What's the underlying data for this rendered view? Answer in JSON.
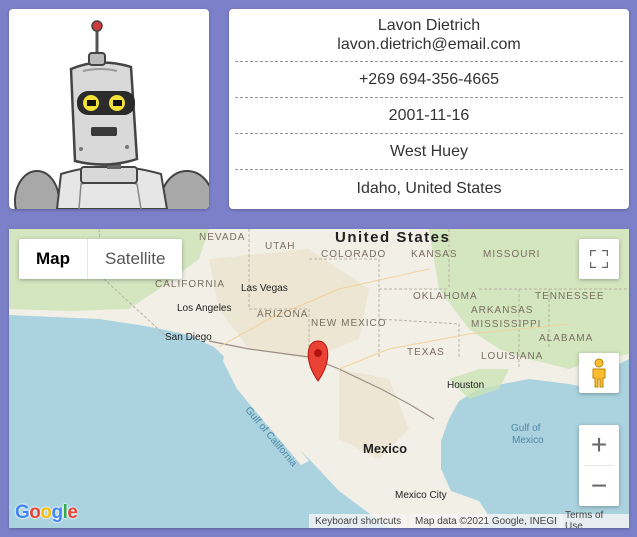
{
  "profile": {
    "name": "Lavon Dietrich",
    "email": "lavon.dietrich@email.com",
    "phone": "+269 694-356-4665",
    "birthdate": "2001-11-16",
    "city": "West Huey",
    "location": "Idaho, United States"
  },
  "map": {
    "type_control": {
      "map": "Map",
      "satellite": "Satellite",
      "selected": "Map"
    },
    "zoom_in": "+",
    "zoom_out": "−",
    "labels": {
      "united_states": "United States",
      "mexico": "Mexico",
      "nevada": "NEVADA",
      "utah": "UTAH",
      "colorado": "COLORADO",
      "kansas": "KANSAS",
      "missouri": "MISSOURI",
      "california": "CALIFORNIA",
      "las_vegas": "Las Vegas",
      "oklahoma": "OKLAHOMA",
      "tennessee": "TENNESSEE",
      "los_angeles": "Los Angeles",
      "arizona": "ARIZONA",
      "arkansas": "ARKANSAS",
      "new_mexico": "NEW MEXICO",
      "mississippi": "MISSISSIPPI",
      "san_diego": "San Diego",
      "alabama": "ALABAMA",
      "texas": "TEXAS",
      "louisiana": "LOUISIANA",
      "houston": "Houston",
      "gulf_of_california": "Gulf of California",
      "gulf_of_mexico_1": "Gulf of",
      "gulf_of_mexico_2": "Mexico",
      "mexico_city": "Mexico City"
    },
    "attribution": {
      "shortcuts": "Keyboard shortcuts",
      "data": "Map data ©2021 Google, INEGI",
      "terms": "Terms of Use"
    },
    "logo_text": "Google",
    "colors": {
      "water": "#aad3df",
      "land": "#f2efe6",
      "green": "#cbe3b6",
      "desert": "#ece4cf",
      "marker": "#ea4335"
    }
  }
}
